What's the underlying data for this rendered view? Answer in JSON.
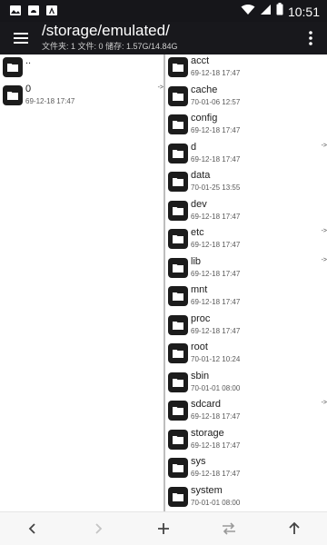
{
  "status_bar": {
    "time": "10:51",
    "left_icons": [
      "image-icon",
      "android-icon",
      "text-icon"
    ],
    "right_icons": [
      "wifi-icon",
      "signal-icon",
      "battery-icon"
    ]
  },
  "app_bar": {
    "title": "/storage/emulated/",
    "subtitle": "文件夹: 1  文件: 0  储存: 1.57G/14.84G"
  },
  "left_pane": {
    "items": [
      {
        "name": "..",
        "date": "",
        "arrow": ""
      },
      {
        "name": "0",
        "date": "69-12-18 17:47",
        "arrow": "->"
      }
    ]
  },
  "right_pane": {
    "items": [
      {
        "name": "acct",
        "date": "69-12-18 17:47",
        "arrow": ""
      },
      {
        "name": "cache",
        "date": "70-01-06 12:57",
        "arrow": ""
      },
      {
        "name": "config",
        "date": "69-12-18 17:47",
        "arrow": ""
      },
      {
        "name": "d",
        "date": "69-12-18 17:47",
        "arrow": "->"
      },
      {
        "name": "data",
        "date": "70-01-25 13:55",
        "arrow": ""
      },
      {
        "name": "dev",
        "date": "69-12-18 17:47",
        "arrow": ""
      },
      {
        "name": "etc",
        "date": "69-12-18 17:47",
        "arrow": "->"
      },
      {
        "name": "lib",
        "date": "69-12-18 17:47",
        "arrow": "->"
      },
      {
        "name": "mnt",
        "date": "69-12-18 17:47",
        "arrow": ""
      },
      {
        "name": "proc",
        "date": "69-12-18 17:47",
        "arrow": ""
      },
      {
        "name": "root",
        "date": "70-01-12 10:24",
        "arrow": ""
      },
      {
        "name": "sbin",
        "date": "70-01-01 08:00",
        "arrow": ""
      },
      {
        "name": "sdcard",
        "date": "69-12-18 17:47",
        "arrow": "->"
      },
      {
        "name": "storage",
        "date": "69-12-18 17:47",
        "arrow": ""
      },
      {
        "name": "sys",
        "date": "69-12-18 17:47",
        "arrow": ""
      },
      {
        "name": "system",
        "date": "70-01-01 08:00",
        "arrow": ""
      }
    ]
  },
  "bottom_bar": {
    "buttons": [
      "back-icon",
      "forward-icon",
      "add-icon",
      "swap-icon",
      "up-icon"
    ]
  }
}
